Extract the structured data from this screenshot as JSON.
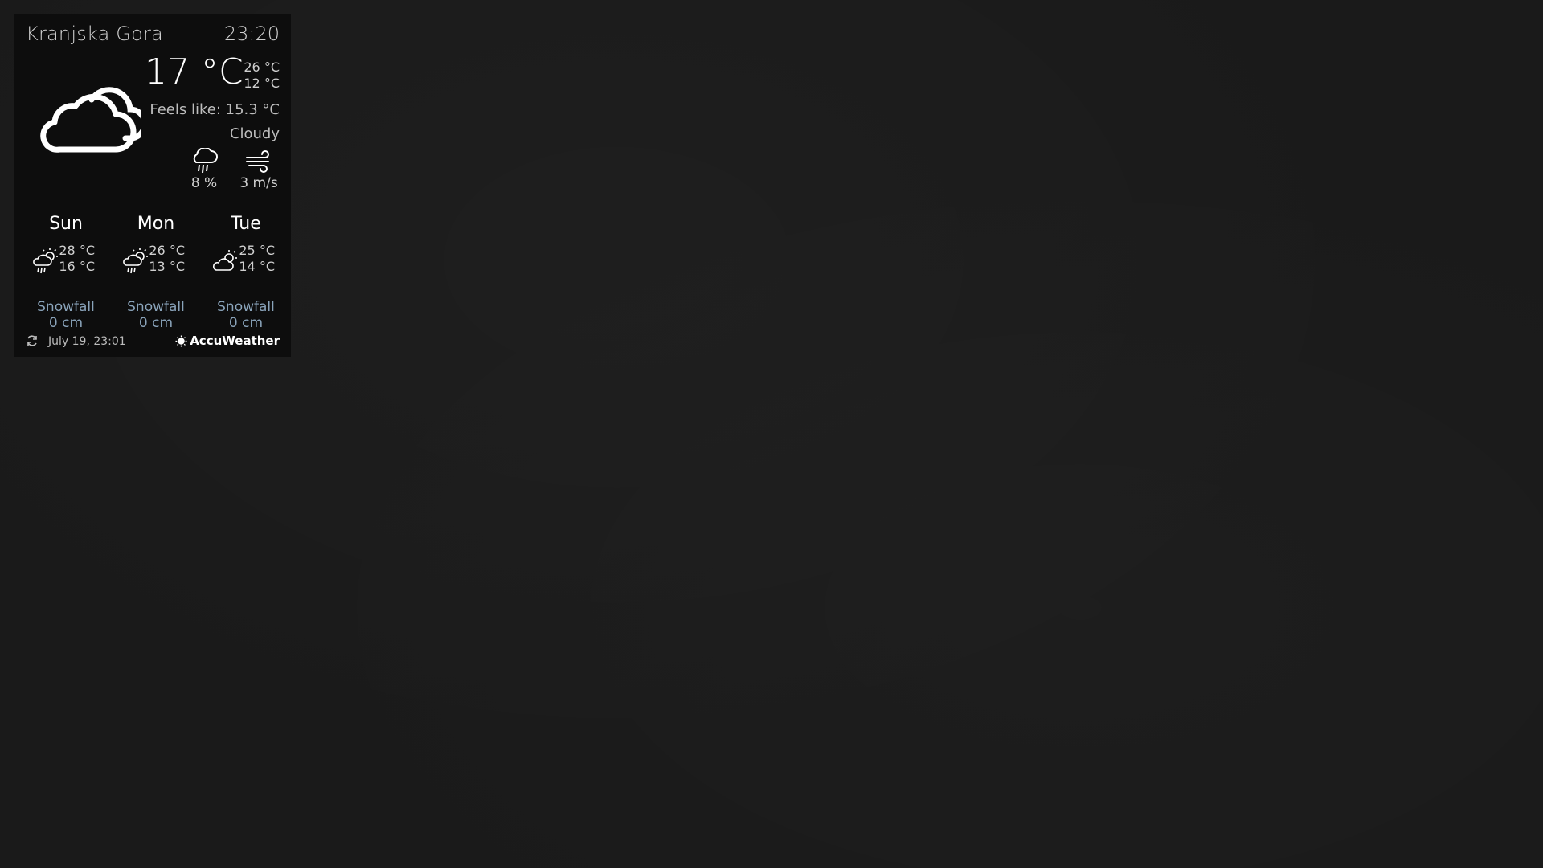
{
  "header": {
    "location": "Kranjska Gora",
    "time": "23:20"
  },
  "current": {
    "icon": "cloud-icon",
    "temperature": "17 °C",
    "high": "26 °C",
    "low": "12 °C",
    "feels_like": "Feels like: 15.3 °C",
    "condition": "Cloudy",
    "precipitation": {
      "icon": "rain-cloud-icon",
      "value": "8 %"
    },
    "wind": {
      "icon": "wind-icon",
      "value": "3 m/s"
    }
  },
  "forecast": [
    {
      "day": "Sun",
      "icon": "sun-rain-icon",
      "high": "28 °C",
      "low": "16 °C",
      "snow_label": "Snowfall",
      "snow_value": "0 cm"
    },
    {
      "day": "Mon",
      "icon": "sun-rain-icon",
      "high": "26 °C",
      "low": "13 °C",
      "snow_label": "Snowfall",
      "snow_value": "0 cm"
    },
    {
      "day": "Tue",
      "icon": "sun-cloud-icon",
      "high": "25 °C",
      "low": "14 °C",
      "snow_label": "Snowfall",
      "snow_value": "0 cm"
    }
  ],
  "footer": {
    "refresh_icon": "refresh-icon",
    "updated": "July 19, 23:01",
    "brand": "AccuWeather"
  },
  "colors": {
    "background": "#1a1a1a",
    "panel": "#0d0d0d",
    "text": "#ffffff",
    "muted": "#cfcfcf",
    "snow": "#8aa4bb"
  }
}
